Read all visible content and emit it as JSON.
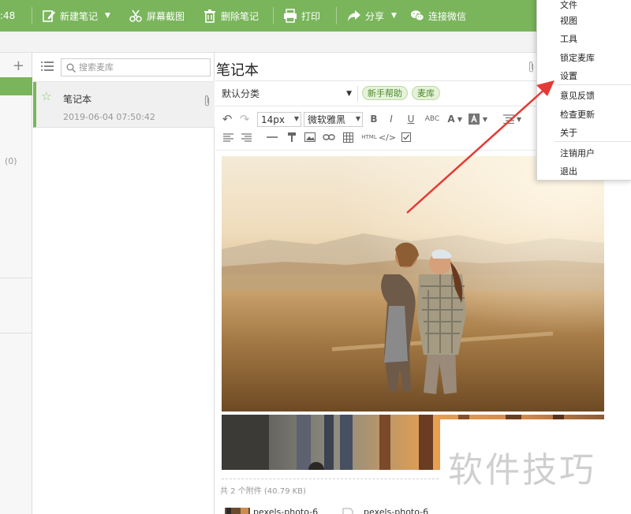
{
  "toolbar": {
    "time_fragment": ":48",
    "new_note": "新建笔记",
    "screenshot": "屏幕截图",
    "delete_note": "删除笔记",
    "print": "打印",
    "share": "分享",
    "connect_wechat": "连接微信",
    "color": "#7ab55c"
  },
  "sidebar": {
    "add_label": "+",
    "count": "(0)"
  },
  "notelist": {
    "search_placeholder": "搜索麦库",
    "notes": [
      {
        "title": "笔记本",
        "date": "2019-06-04 07:50:42"
      }
    ]
  },
  "editor": {
    "title": "笔记本",
    "category": "默认分类",
    "tags": [
      "新手帮助",
      "麦库"
    ],
    "font_size": "14px",
    "font_family": "微软雅黑",
    "format_labels": {
      "bold": "B",
      "italic": "I",
      "underline": "U",
      "strikethrough": "ABC",
      "font_color": "A",
      "html": "HTML",
      "code": "</>"
    },
    "attachments_summary": "共 2 个附件 (40.79 KB)",
    "attachments": [
      "pexels-photo-6",
      "pexels-photo-6"
    ]
  },
  "menu": {
    "items_group1": [
      "文件",
      "视图",
      "工具",
      "锁定麦库",
      "设置"
    ],
    "items_group2": [
      "意见反馈",
      "检查更新",
      "关于"
    ],
    "items_group3": [
      "注销用户",
      "退出"
    ]
  },
  "watermark": "软件技巧"
}
